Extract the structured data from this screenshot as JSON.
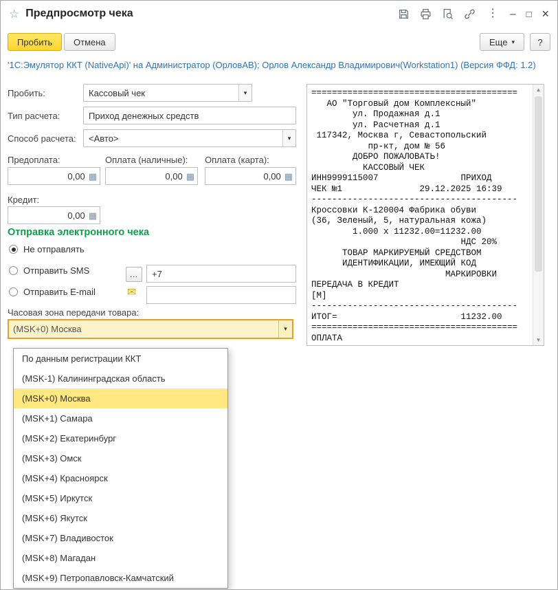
{
  "window": {
    "title": "Предпросмотр чека"
  },
  "toolbar": {
    "commit": "Пробить",
    "cancel": "Отмена",
    "more": "Еще",
    "help": "?"
  },
  "info_line": "'1С:Эмулятор ККТ (NativeApi)' на Администратор (ОрловАВ); Орлов Александр Владимирович(Workstation1) (Версия ФФД: 1.2)",
  "form": {
    "operation": {
      "label": "Пробить:",
      "value": "Кассовый чек"
    },
    "calc_type": {
      "label": "Тип расчета:",
      "value": "Приход денежных средств"
    },
    "calc_method": {
      "label": "Способ расчета:",
      "value": "<Авто>"
    },
    "prepayment": {
      "label": "Предоплата:",
      "value": "0,00"
    },
    "payment_cash": {
      "label": "Оплата (наличные):",
      "value": "0,00"
    },
    "payment_card": {
      "label": "Оплата (карта):",
      "value": "0,00"
    },
    "credit": {
      "label": "Кредит:",
      "value": "0,00"
    },
    "e_receipt": {
      "header": "Отправка электронного чека",
      "option_none": "Не отправлять",
      "option_sms": "Отправить SMS",
      "sms_value": "+7",
      "option_email": "Отправить E-mail",
      "email_value": ""
    },
    "timezone": {
      "label": "Часовая зона передачи товара:",
      "value": "(MSK+0) Москва"
    }
  },
  "timezone_dropdown": {
    "selected": "(MSK+0) Москва",
    "items": [
      "По данным регистрации ККТ",
      "(MSK-1) Калининградская область",
      "(MSK+0) Москва",
      "(MSK+1) Самара",
      "(MSK+2) Екатеринбург",
      "(MSK+3) Омск",
      "(MSK+4) Красноярск",
      "(MSK+5) Иркутск",
      "(MSK+6) Якутск",
      "(MSK+7) Владивосток",
      "(MSK+8) Магадан",
      "(MSK+9) Петропавловск-Камчатский"
    ]
  },
  "receipt": {
    "lines": [
      "========================================",
      "   АО \"Торговый дом Комплексный\"",
      "        ул. Продажная д.1",
      "        ул. Расчетная д.1",
      " 117342, Москва г, Севастопольский",
      "           пр-кт, дом № 56",
      "        ДОБРО ПОЖАЛОВАТЬ!",
      "          КАССОВЫЙ ЧЕК",
      "ИНН9999115007                ПРИХОД",
      "ЧЕК №1               29.12.2025 16:39",
      "----------------------------------------",
      "Кроссовки К-120004 Фабрика обуви",
      "(36, Зеленый, 5, натуральная кожа)",
      "        1.000 x 11232.00=11232.00",
      "                             НДС 20%",
      "      ТОВАР МАРКИРУЕМЫЙ СРЕДСТВОМ",
      "      ИДЕНТИФИКАЦИИ, ИМЕЮЩИЙ КОД",
      "                          МАРКИРОВКИ",
      "ПЕРЕДАЧА В КРЕДИТ",
      "[M]",
      "----------------------------------------",
      "ИТОГ=                        11232.00",
      "========================================",
      "ОПЛАТА"
    ]
  },
  "colors": {
    "primary_button_yellow": "#ffd42e",
    "selection_highlight_yellow": "#ffe87f",
    "section_header_green": "#0ca04a",
    "info_link_blue": "#3372b5",
    "focus_border_orange": "#e2a033"
  }
}
